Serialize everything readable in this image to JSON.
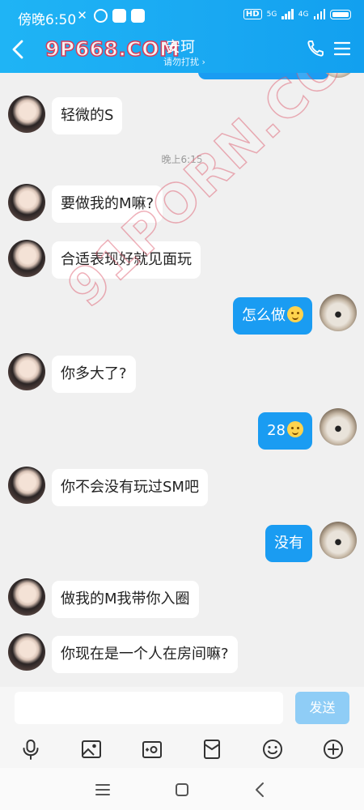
{
  "status": {
    "time": "傍晚6:50",
    "hd": "HD",
    "net1": "5G",
    "net2": "4G"
  },
  "header": {
    "title": "安珂",
    "subtitle": "请勿打扰 ›",
    "watermark": "9P668.COM"
  },
  "watermark_diag": "91PORN.COM",
  "messages": [
    {
      "side": "in",
      "text": "轻微的S"
    },
    {
      "side": "time",
      "text": "晚上6:15"
    },
    {
      "side": "in",
      "text": "要做我的M嘛?"
    },
    {
      "side": "in",
      "text": "合适表现好就见面玩"
    },
    {
      "side": "out",
      "text": "怎么做",
      "emoji": "flushed-emoji"
    },
    {
      "side": "in",
      "text": "你多大了?"
    },
    {
      "side": "out",
      "text": "28",
      "emoji": "smile-emoji"
    },
    {
      "side": "in",
      "text": "你不会没有玩过SM吧"
    },
    {
      "side": "out",
      "text": "没有"
    },
    {
      "side": "in",
      "text": "做我的M我带你入圈"
    },
    {
      "side": "in",
      "text": "你现在是一个人在房间嘛?"
    }
  ],
  "input": {
    "placeholder": "",
    "send_label": "发送"
  },
  "toolbar": [
    "microphone-icon",
    "image-icon",
    "camera-icon",
    "red-packet-icon",
    "emoji-icon",
    "plus-icon"
  ],
  "nav": [
    "menu-icon",
    "home-icon",
    "back-icon"
  ],
  "colors": {
    "header": "#19a8f2",
    "outgoing": "#1a9cf2",
    "incoming": "#ffffff",
    "send_disabled": "#8fcdf6"
  }
}
